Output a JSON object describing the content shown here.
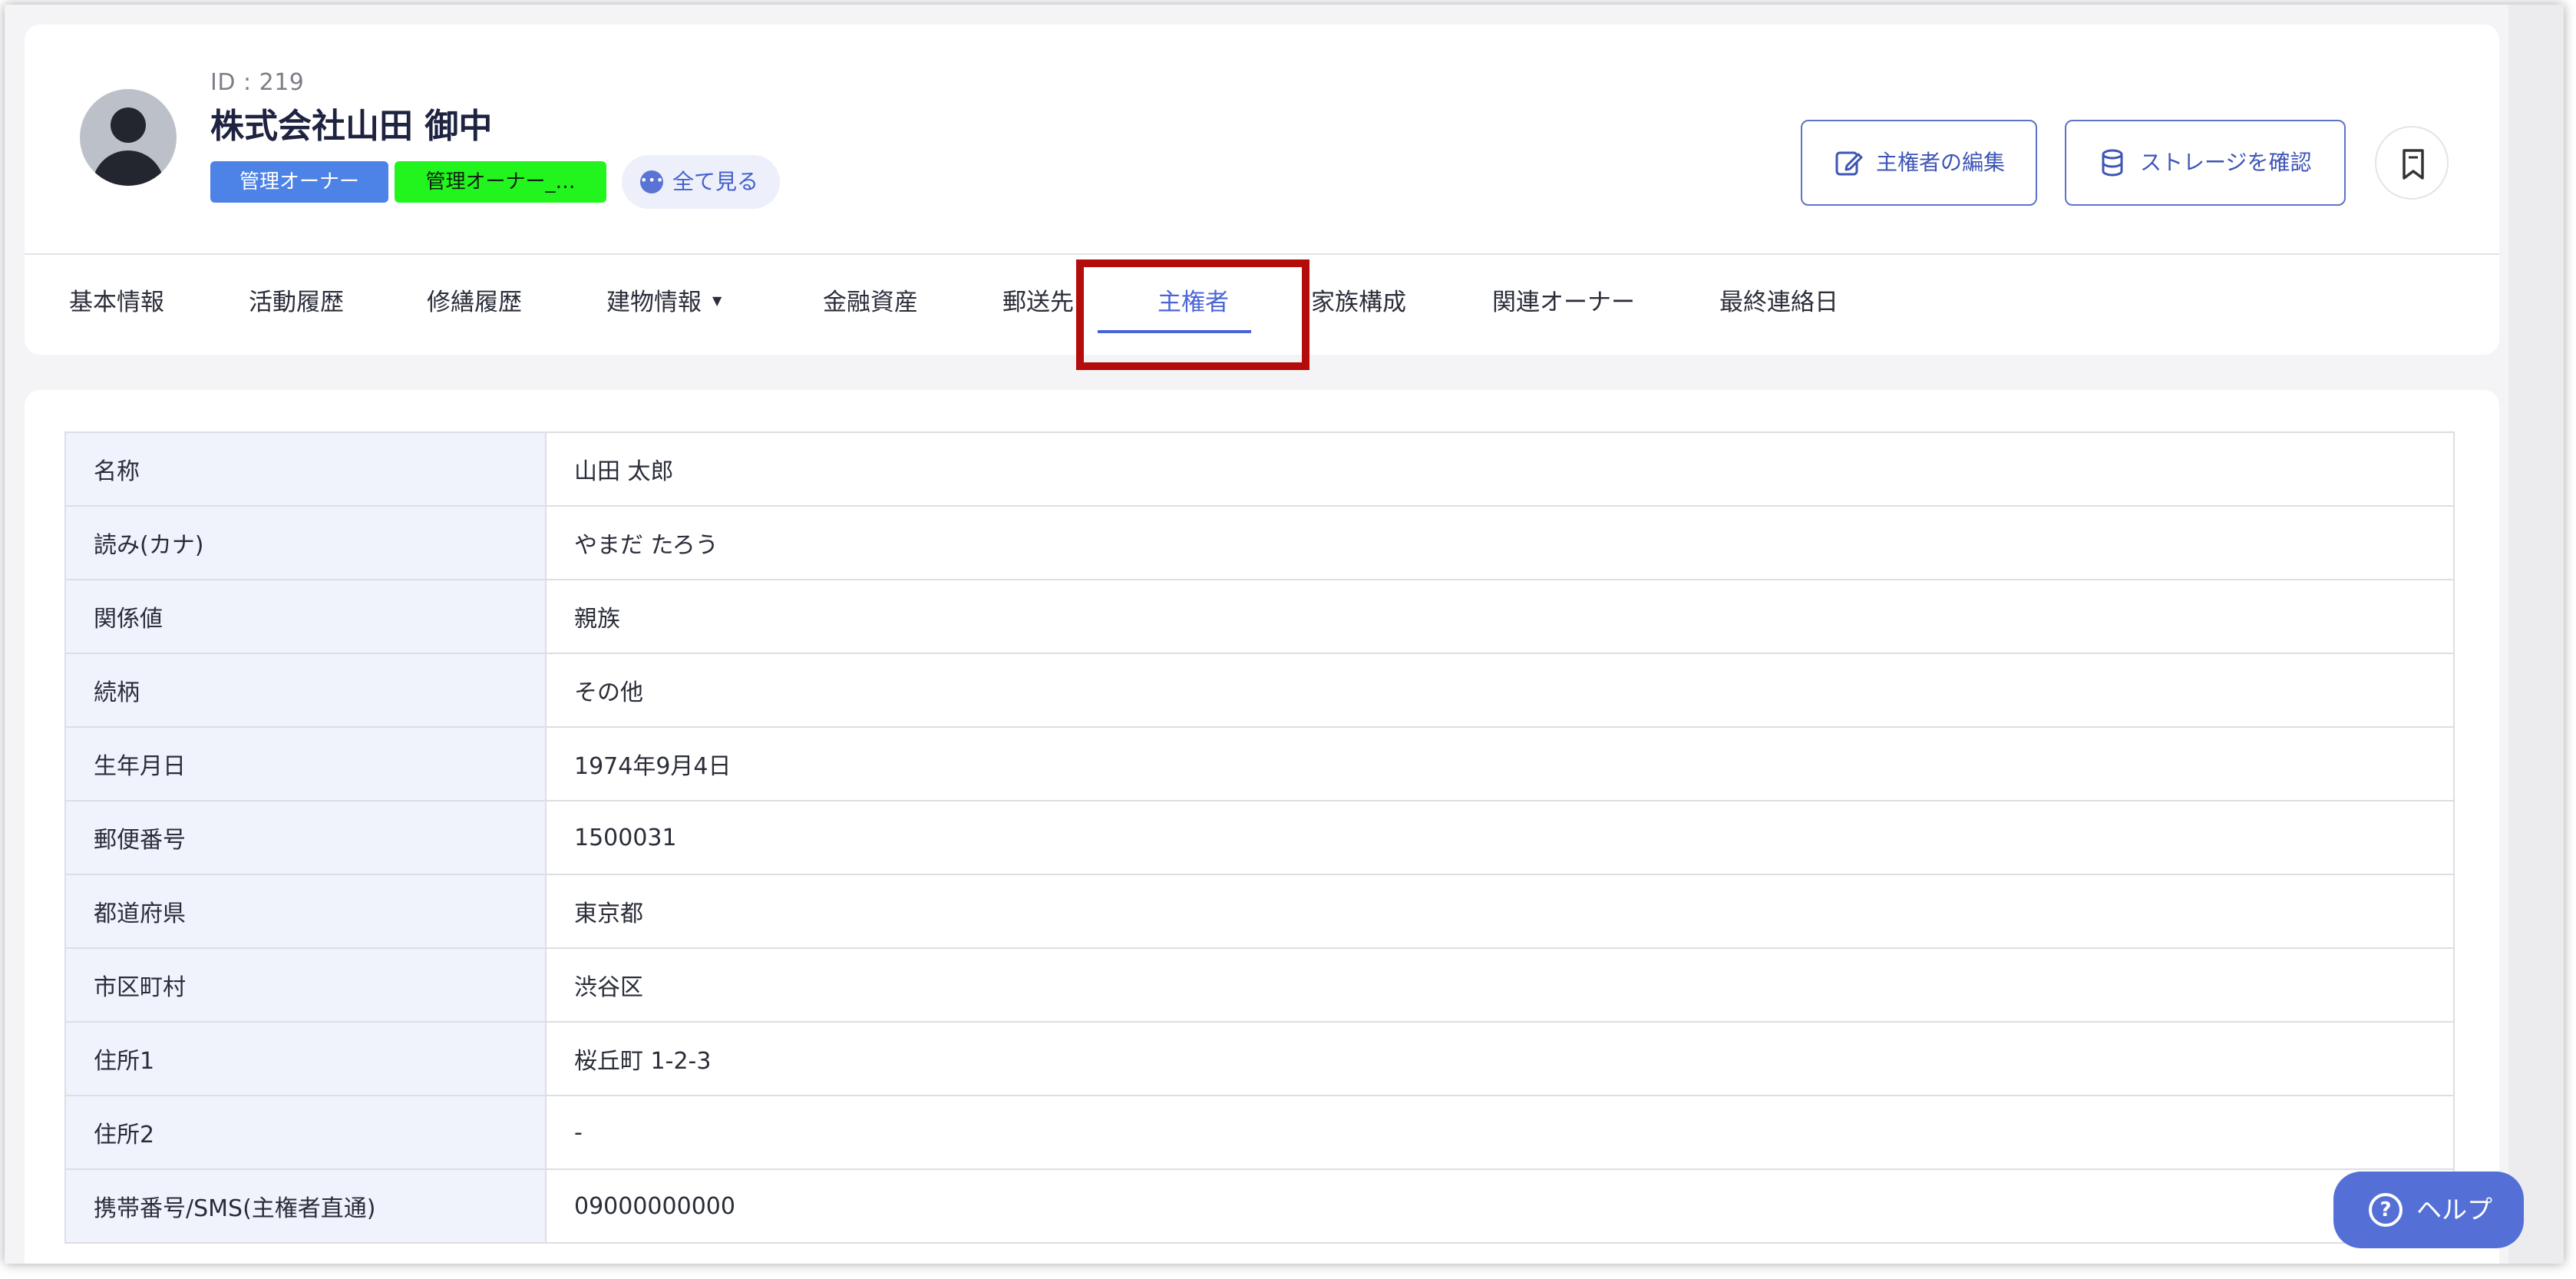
{
  "header": {
    "owner_id": "ID : 219",
    "owner_name": "株式会社山田 御中",
    "badges": [
      {
        "label": "管理オーナー",
        "color": "#4d82e6"
      },
      {
        "label": "管理オーナー_…",
        "color": "#22f51e"
      }
    ],
    "see_all_label": "全て見る",
    "edit_button_label": "主権者の編集",
    "storage_button_label": "ストレージを確認"
  },
  "tabs": [
    {
      "label": "基本情報"
    },
    {
      "label": "活動履歴"
    },
    {
      "label": "修繕履歴"
    },
    {
      "label": "建物情報"
    },
    {
      "label": "金融資産"
    },
    {
      "label": "郵送先"
    },
    {
      "label": "主権者",
      "active": true
    },
    {
      "label": "家族構成"
    },
    {
      "label": "関連オーナー"
    },
    {
      "label": "最終連絡日"
    }
  ],
  "details": [
    {
      "label": "名称",
      "value": "山田 太郎"
    },
    {
      "label": "読み(カナ)",
      "value": "やまだ たろう"
    },
    {
      "label": "関係値",
      "value": "親族"
    },
    {
      "label": "続柄",
      "value": "その他"
    },
    {
      "label": "生年月日",
      "value": "1974年9月4日"
    },
    {
      "label": "郵便番号",
      "value": "1500031"
    },
    {
      "label": "都道府県",
      "value": "東京都"
    },
    {
      "label": "市区町村",
      "value": "渋谷区"
    },
    {
      "label": "住所1",
      "value": "桜丘町 1-2-3"
    },
    {
      "label": "住所2",
      "value": "-"
    },
    {
      "label": "携帯番号/SMS(主権者直通)",
      "value": "09000000000"
    }
  ],
  "help_button_label": "ヘルプ",
  "colors": {
    "accent": "#4a64d6",
    "highlight_box": "#b40b0b",
    "label_cell_bg": "#f1f3fc"
  }
}
